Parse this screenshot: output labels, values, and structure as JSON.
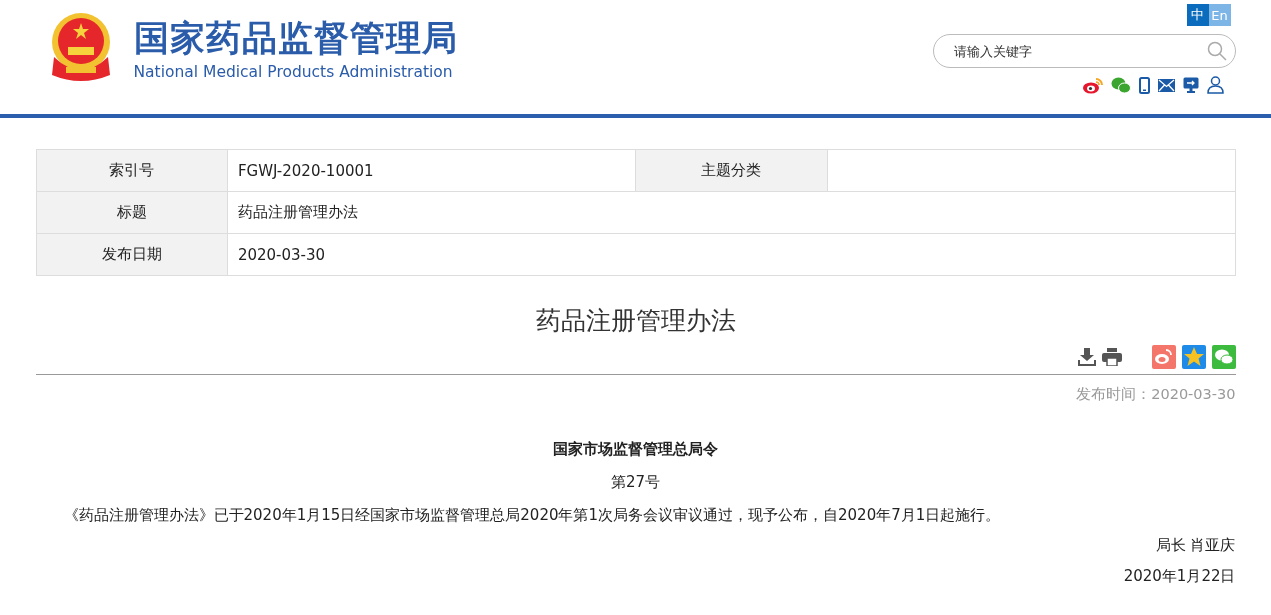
{
  "header": {
    "title_cn": "国家药品监督管理局",
    "title_en": "National Medical Products Administration",
    "languages": [
      {
        "label": "中",
        "selected": true
      },
      {
        "label": "En",
        "selected": false
      }
    ],
    "search": {
      "placeholder": "请输入关键字"
    }
  },
  "meta_table": {
    "rows": [
      {
        "cells": [
          {
            "label": "索引号",
            "value": "FGWJ-2020-10001"
          },
          {
            "label": "主题分类"
          }
        ]
      },
      {
        "cells": [
          {
            "label": "标题",
            "value": "药品注册管理办法"
          }
        ]
      },
      {
        "cells": [
          {
            "label": "发布日期",
            "value": "2020-03-30"
          }
        ]
      }
    ]
  },
  "article": {
    "title": "药品注册管理办法",
    "publish_time": "发布时间：2020-03-30",
    "decree": "国家市场监督管理总局令",
    "number": "第27号",
    "paragraph": "《药品注册管理办法》已于2020年1月15日经国家市场监督管理总局2020年第1次局务会议审议通过，现予公布，自2020年7月1日起施行。",
    "signature": "局长 肖亚庆",
    "date": "2020年1月22日"
  }
}
